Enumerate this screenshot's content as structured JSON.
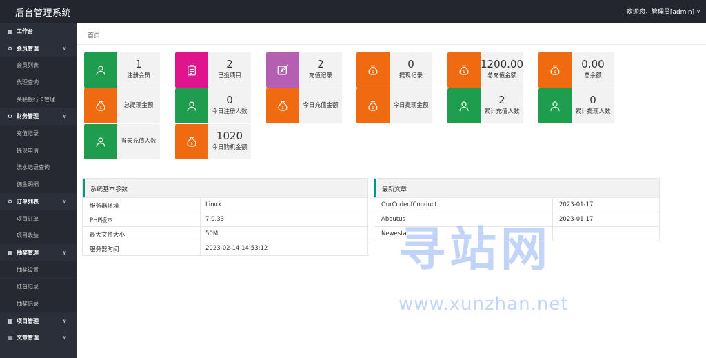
{
  "header": {
    "brand": "后台管理系统",
    "user": "欢迎您，管理员[admin]"
  },
  "breadcrumb": "首页",
  "sidebar": {
    "items": [
      {
        "label": "工作台",
        "type": "group",
        "icon": "dashboard-icon",
        "caret": false
      },
      {
        "label": "会员管理",
        "type": "group",
        "icon": "settings-icon",
        "caret": true
      },
      {
        "label": "会员列表",
        "type": "sub"
      },
      {
        "label": "代理查询",
        "type": "sub"
      },
      {
        "label": "关联银行卡管理",
        "type": "sub"
      },
      {
        "label": "财务管理",
        "type": "group",
        "icon": "settings-icon",
        "caret": true
      },
      {
        "label": "充值记录",
        "type": "sub"
      },
      {
        "label": "提现申请",
        "type": "sub"
      },
      {
        "label": "流水记录查询",
        "type": "sub"
      },
      {
        "label": "佣金明细",
        "type": "sub"
      },
      {
        "label": "订单列表",
        "type": "group",
        "icon": "settings-icon",
        "caret": true
      },
      {
        "label": "项目订单",
        "type": "sub"
      },
      {
        "label": "项目收益",
        "type": "sub"
      },
      {
        "label": "抽奖管理",
        "type": "group",
        "icon": "dashboard-icon",
        "caret": true
      },
      {
        "label": "抽奖设置",
        "type": "sub"
      },
      {
        "label": "红包记录",
        "type": "sub"
      },
      {
        "label": "抽奖记录",
        "type": "sub"
      },
      {
        "label": "项目管理",
        "type": "group",
        "icon": "grid-icon",
        "caret": true
      },
      {
        "label": "文章管理",
        "type": "group",
        "icon": "document-icon",
        "caret": true
      }
    ]
  },
  "cards": [
    {
      "value": "1",
      "label": "注册会员",
      "color": "#1d9d4d",
      "icon": "user-icon"
    },
    {
      "value": "2",
      "label": "已投项目",
      "color": "#e0158d",
      "icon": "clipboard-icon"
    },
    {
      "value": "2",
      "label": "充值记录",
      "color": "#b55fb3",
      "icon": "edit-icon"
    },
    {
      "value": "0",
      "label": "提现记录",
      "color": "#f06a0f",
      "icon": "money-bag-icon"
    },
    {
      "value": "1200.00",
      "label": "总充值金额",
      "color": "#f06a0f",
      "icon": "money-bag-icon"
    },
    {
      "value": "0.00",
      "label": "总余额",
      "color": "#f06a0f",
      "icon": "money-bag-icon"
    },
    {
      "value": "",
      "label": "总提现金额",
      "color": "#f06a0f",
      "icon": "money-bag-icon"
    },
    {
      "value": "0",
      "label": "今日注册人数",
      "color": "#1d9d4d",
      "icon": "user-icon"
    },
    {
      "value": "",
      "label": "今日充值金额",
      "color": "#f06a0f",
      "icon": "money-bag-icon"
    },
    {
      "value": "",
      "label": "今日提现金额",
      "color": "#f06a0f",
      "icon": "money-bag-icon"
    },
    {
      "value": "2",
      "label": "累计充值人数",
      "color": "#1d9d4d",
      "icon": "user-icon"
    },
    {
      "value": "0",
      "label": "累计提现人数",
      "color": "#1d9d4d",
      "icon": "user-icon"
    },
    {
      "value": "",
      "label": "当天充值人数",
      "color": "#1d9d4d",
      "icon": "user-icon"
    },
    {
      "value": "1020",
      "label": "今日购机金额",
      "color": "#f06a0f",
      "icon": "money-bag-icon"
    }
  ],
  "system_panel": {
    "title": "系统基本参数",
    "rows": [
      {
        "key": "服务器环境",
        "value": "Linux"
      },
      {
        "key": "PHP版本",
        "value": "7.0.33"
      },
      {
        "key": "最大文件大小",
        "value": "50M"
      },
      {
        "key": "服务器时间",
        "value": "2023-02-14 14:53:12"
      }
    ]
  },
  "articles_panel": {
    "title": "最新文章",
    "rows": [
      {
        "title": "OurCodeofConduct",
        "date": "2023-01-17"
      },
      {
        "title": "Aboutus",
        "date": "2023-01-17"
      },
      {
        "title": "Newesta",
        "date": ""
      }
    ]
  },
  "watermark": {
    "title": "寻站网",
    "url": "www.xunzhan.net"
  }
}
